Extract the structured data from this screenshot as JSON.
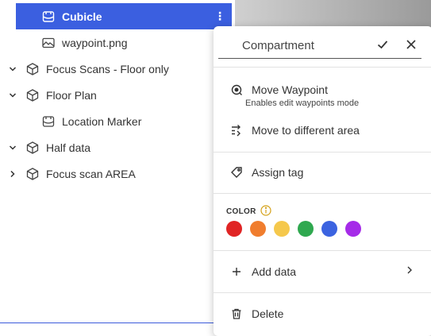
{
  "tree": {
    "items": [
      {
        "label": "Cubicle",
        "icon": "compartment-icon",
        "selected": true
      },
      {
        "label": "waypoint.png",
        "icon": "image-icon"
      },
      {
        "label": "Focus Scans - Floor only",
        "icon": "cube-icon",
        "expand": "chevron-down-icon"
      },
      {
        "label": "Floor Plan",
        "icon": "cube-icon",
        "expand": "chevron-down-icon"
      },
      {
        "label": "Location Marker",
        "icon": "compartment-icon"
      },
      {
        "label": "Half data",
        "icon": "cube-icon",
        "expand": "chevron-down-icon"
      },
      {
        "label": "Focus scan AREA",
        "icon": "cube-icon",
        "expand": "chevron-right-icon"
      }
    ],
    "selected_kebab": "⋮"
  },
  "menu": {
    "title": "Compartment",
    "move_waypoint": "Move Waypoint",
    "move_waypoint_sub": "Enables edit waypoints mode",
    "move_area": "Move to different area",
    "assign_tag": "Assign tag",
    "color_label": "COLOR",
    "colors": [
      "#e02424",
      "#f07d2e",
      "#f5c84c",
      "#2fa84f",
      "#3b63e0",
      "#a52be8"
    ],
    "add_data": "Add data",
    "delete": "Delete"
  },
  "theme": {
    "selected_bg": "#3b5fe0",
    "info_color": "#d4a017"
  }
}
